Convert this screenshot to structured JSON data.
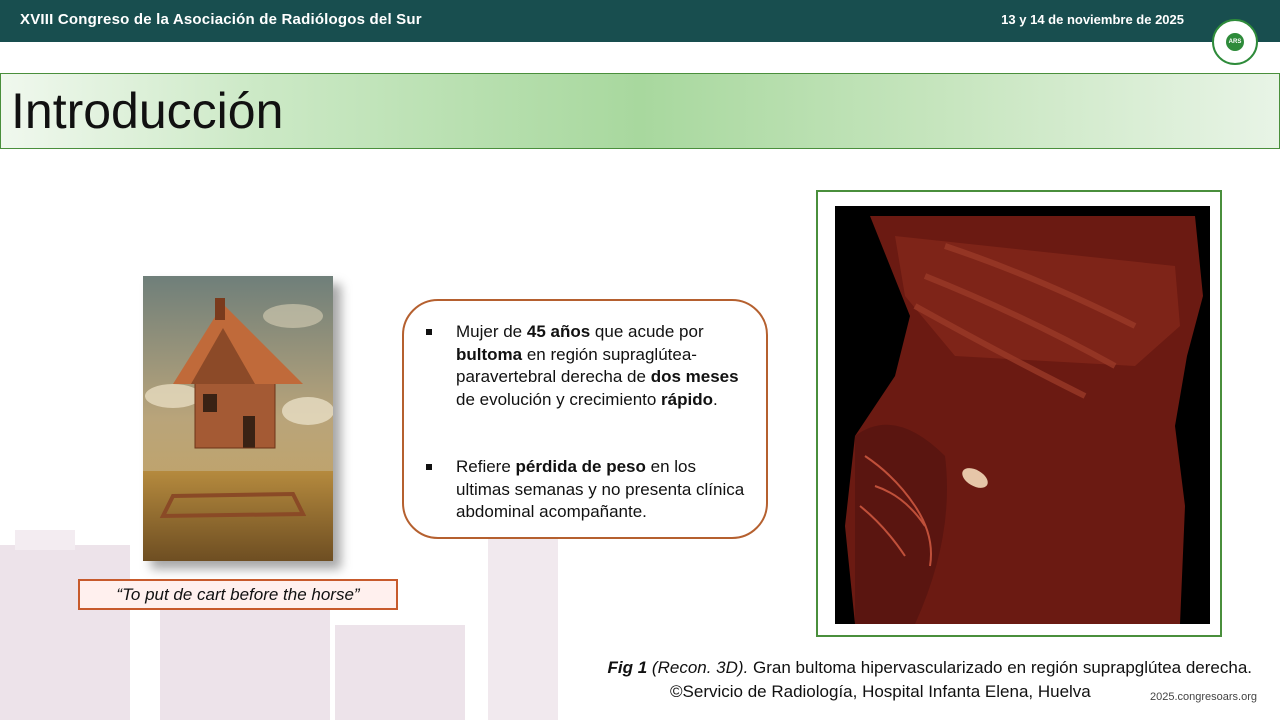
{
  "header": {
    "event_title": "XVIII Congreso de la Asociación de Radiólogos del Sur",
    "date": "13 y 14 de noviembre de 2025",
    "logo_text": "ARS"
  },
  "slide": {
    "title": "Introducción"
  },
  "painting": {
    "icon": "floating-house-painting"
  },
  "quote": "“To put de cart before the horse”",
  "bullets": [
    {
      "parts": [
        {
          "text": "Mujer de ",
          "bold": false
        },
        {
          "text": "45 años",
          "bold": true
        },
        {
          "text": " que acude por ",
          "bold": false
        },
        {
          "text": "bultoma",
          "bold": true
        },
        {
          "text": " en región supraglútea-paravertebral derecha de ",
          "bold": false
        },
        {
          "text": "dos meses",
          "bold": true
        },
        {
          "text": " de evolución y crecimiento ",
          "bold": false
        },
        {
          "text": "rápido",
          "bold": true
        },
        {
          "text": ".",
          "bold": false
        }
      ]
    },
    {
      "parts": [
        {
          "text": "Refiere ",
          "bold": false
        },
        {
          "text": "pérdida de peso",
          "bold": true
        },
        {
          "text": " en los ultimas semanas y no presenta clínica abdominal acompañante.",
          "bold": false
        }
      ]
    }
  ],
  "figure": {
    "caption_label": "Fig 1",
    "caption_method": " (Recon. 3D).",
    "caption_text": " Gran bultoma hipervascularizado en región suprapglútea derecha.",
    "credit": "©Servicio de Radiología, Hospital Infanta Elena, Huelva"
  },
  "footer": {
    "website": "2025.congresoars.org"
  },
  "colors": {
    "header_bg": "#184e4f",
    "accent_green": "#4a8f3c",
    "accent_orange": "#b5602f"
  }
}
